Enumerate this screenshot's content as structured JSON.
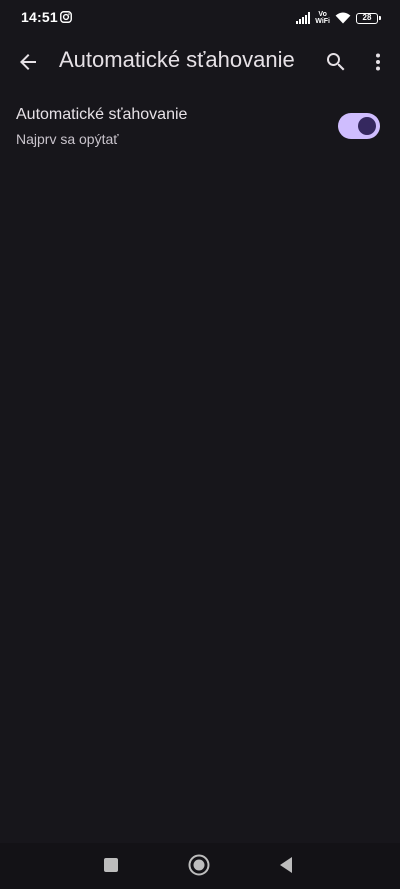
{
  "status_bar": {
    "time": "14:51",
    "vowifi_top": "Vo",
    "vowifi_bottom": "WiFi",
    "battery_level": "28",
    "icons": [
      "instagram-icon",
      "signal-icon",
      "wifi-icon",
      "battery-icon"
    ]
  },
  "app_bar": {
    "title": "Automatické sťahovanie",
    "icons": [
      "arrow-back-icon",
      "search-icon",
      "more-vert-icon"
    ]
  },
  "setting": {
    "title": "Automatické sťahovanie",
    "summary": "Najprv sa opýtať",
    "toggle_on": true
  },
  "nav_bar": {
    "icons": [
      "recents-square-icon",
      "home-circle-icon",
      "back-triangle-icon"
    ]
  },
  "colors": {
    "background": "#17161b",
    "text_primary": "#e6e1e6",
    "text_secondary": "#c9c4cc",
    "switch_track": "#cfbdfe",
    "switch_thumb": "#35285f",
    "nav_bar": "#131216"
  }
}
